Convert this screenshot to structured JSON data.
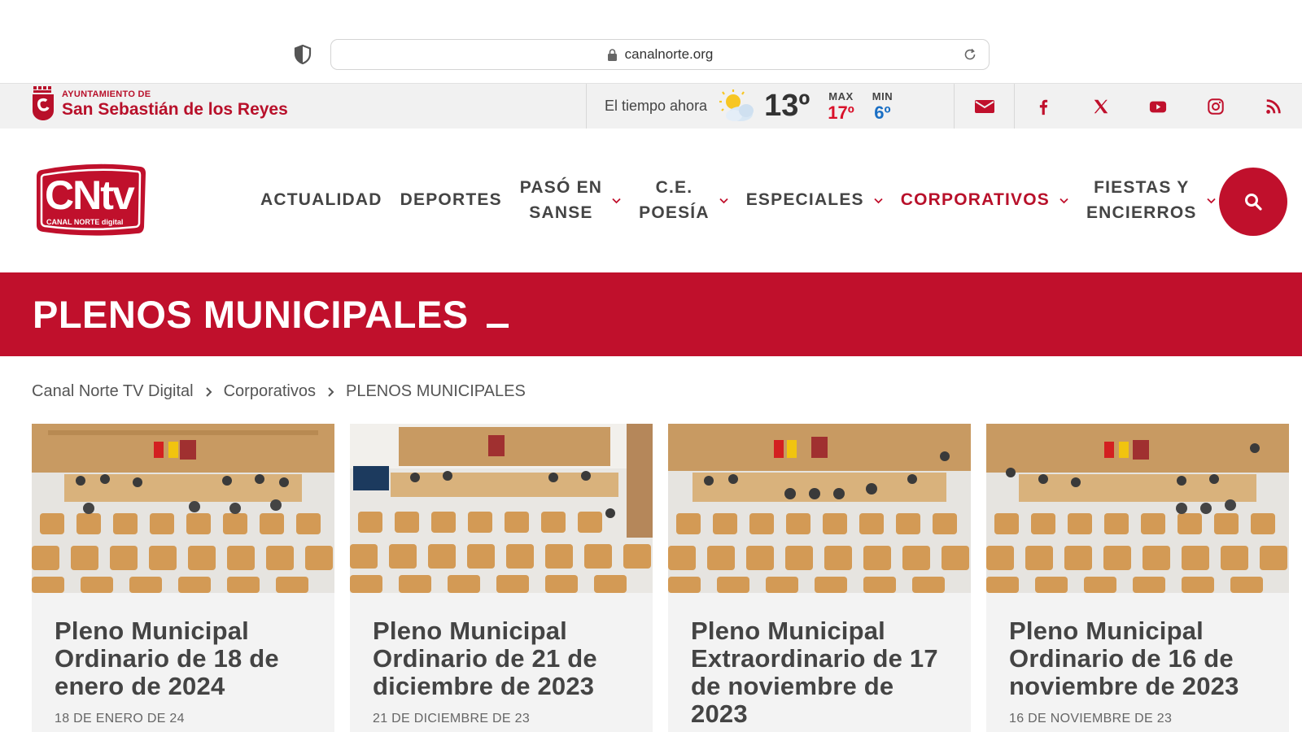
{
  "browser": {
    "url": "canalnorte.org"
  },
  "topbar": {
    "muni_small": "AYUNTAMIENTO DE",
    "muni_big": "San Sebastián de los Reyes",
    "weather_label": "El tiempo ahora",
    "temp": "13º",
    "max_label": "MAX",
    "max_value": "17º",
    "min_label": "MIN",
    "min_value": "6º",
    "colors": {
      "max": "#d9122b",
      "min": "#1a6fc4"
    }
  },
  "logo": {
    "main": "CNtv",
    "sub": "CANAL NORTE digital"
  },
  "nav": [
    {
      "line1": "ACTUALIDAD",
      "line2": "",
      "dropdown": false,
      "active": false
    },
    {
      "line1": "DEPORTES",
      "line2": "",
      "dropdown": false,
      "active": false
    },
    {
      "line1": "PASÓ EN",
      "line2": "SANSE",
      "dropdown": true,
      "active": false
    },
    {
      "line1": "C.E.",
      "line2": "POESÍA",
      "dropdown": true,
      "active": false
    },
    {
      "line1": "ESPECIALES",
      "line2": "",
      "dropdown": true,
      "active": false
    },
    {
      "line1": "CORPORATIVOS",
      "line2": "",
      "dropdown": true,
      "active": true
    },
    {
      "line1": "FIESTAS Y",
      "line2": "ENCIERROS",
      "dropdown": true,
      "active": false
    }
  ],
  "banner": {
    "title": "PLENOS MUNICIPALES"
  },
  "breadcrumb": [
    "Canal Norte TV Digital",
    "Corporativos",
    "PLENOS MUNICIPALES"
  ],
  "cards": [
    {
      "title": "Pleno Municipal Ordinario de 18 de enero de 2024",
      "date": "18 DE ENERO DE 24"
    },
    {
      "title": "Pleno Municipal Ordinario de 21 de diciembre de 2023",
      "date": "21 DE DICIEMBRE DE 23"
    },
    {
      "title": "Pleno Municipal Extraordinario de 17 de noviembre de 2023",
      "date": ""
    },
    {
      "title": "Pleno Municipal Ordinario de 16 de noviembre de 2023",
      "date": "16 DE NOVIEMBRE DE 23"
    }
  ],
  "accent_color": "#c0102c"
}
